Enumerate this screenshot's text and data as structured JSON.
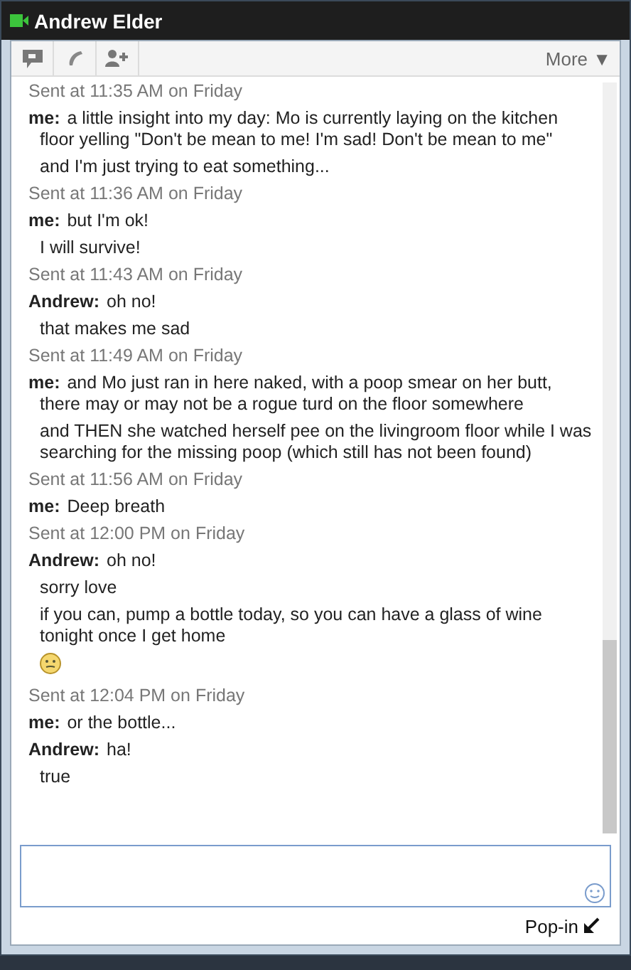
{
  "window": {
    "title": "Andrew Elder"
  },
  "toolbar": {
    "more_label": "More ▼"
  },
  "chat": [
    {
      "kind": "timestamp",
      "text": "Sent at 11:35 AM on Friday"
    },
    {
      "kind": "message",
      "sender": "me:",
      "text": "a little insight into my day: Mo is currently laying on the kitchen floor yelling \"Don't be mean to me! I'm sad! Don't be mean to me\""
    },
    {
      "kind": "line",
      "text": "and I'm just trying to eat something..."
    },
    {
      "kind": "timestamp",
      "text": "Sent at 11:36 AM on Friday"
    },
    {
      "kind": "message",
      "sender": "me:",
      "text": "but I'm ok!"
    },
    {
      "kind": "line",
      "text": "I will survive!"
    },
    {
      "kind": "timestamp",
      "text": "Sent at 11:43 AM on Friday"
    },
    {
      "kind": "message",
      "sender": "Andrew:",
      "text": "oh no!"
    },
    {
      "kind": "line",
      "text": "that makes me sad"
    },
    {
      "kind": "timestamp",
      "text": "Sent at 11:49 AM on Friday"
    },
    {
      "kind": "message",
      "sender": "me:",
      "text": "and Mo just ran in here naked, with a poop smear on her butt, there may or may not be a rogue turd on the floor somewhere"
    },
    {
      "kind": "line",
      "text": "and THEN she watched herself pee on the livingroom floor while I was searching for the missing poop (which still has not been found)"
    },
    {
      "kind": "timestamp",
      "text": "Sent at 11:56 AM on Friday"
    },
    {
      "kind": "message",
      "sender": "me:",
      "text": "Deep breath"
    },
    {
      "kind": "timestamp",
      "text": "Sent at 12:00 PM on Friday"
    },
    {
      "kind": "message",
      "sender": "Andrew:",
      "text": "oh no!"
    },
    {
      "kind": "line",
      "text": "sorry love"
    },
    {
      "kind": "line",
      "text": "if you can, pump a bottle today, so you can have a glass of wine tonight once I get home"
    },
    {
      "kind": "emoji"
    },
    {
      "kind": "timestamp",
      "text": "Sent at 12:04 PM on Friday"
    },
    {
      "kind": "message",
      "sender": "me:",
      "text": "or the bottle..."
    },
    {
      "kind": "message",
      "sender": "Andrew:",
      "text": "ha!"
    },
    {
      "kind": "line",
      "text": "true"
    }
  ],
  "footer": {
    "popin_label": "Pop-in"
  }
}
